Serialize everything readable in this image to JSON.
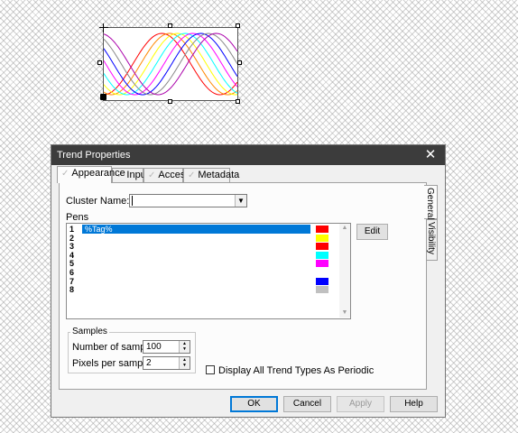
{
  "trend_preview": {
    "pen_colors": [
      "#ff0000",
      "#ff8800",
      "#ffff00",
      "#00ffff",
      "#ff00ff",
      "#0000ff",
      "#888888",
      "#aa00aa"
    ]
  },
  "dialog": {
    "title": "Trend Properties",
    "close_glyph": "✕",
    "tabs": [
      "Appearance",
      "Input",
      "Access",
      "Metadata"
    ],
    "tab_check_glyph": "✓",
    "side_tabs": [
      "General",
      "Visibility"
    ],
    "cluster_label": "Cluster Name:",
    "cluster_value": "",
    "dropdown_glyph": "▼",
    "pens_label": "Pens",
    "pens": [
      {
        "num": "1",
        "tag": "%Tag%",
        "color": "#ff0000"
      },
      {
        "num": "2",
        "tag": "",
        "color": "#ffff00"
      },
      {
        "num": "3",
        "tag": "",
        "color": "#ff0000"
      },
      {
        "num": "4",
        "tag": "",
        "color": "#00ffff"
      },
      {
        "num": "5",
        "tag": "",
        "color": "#ff00ff"
      },
      {
        "num": "6",
        "tag": "",
        "color": ""
      },
      {
        "num": "7",
        "tag": "",
        "color": "#0000ff"
      },
      {
        "num": "8",
        "tag": "",
        "color": "#c0c0c0"
      }
    ],
    "selected_pen": 0,
    "edit_button": "Edit",
    "samples_label": "Samples",
    "num_samples_label": "Number of samples:",
    "num_samples_value": "100",
    "pixels_per_sample_label": "Pixels per sample:",
    "pixels_per_sample_value": "2",
    "spin_up_glyph": "▲",
    "spin_down_glyph": "▼",
    "periodic_label": "Display All Trend Types As Periodic",
    "periodic_checked": false,
    "buttons": {
      "ok": "OK",
      "cancel": "Cancel",
      "apply": "Apply",
      "help": "Help"
    }
  }
}
